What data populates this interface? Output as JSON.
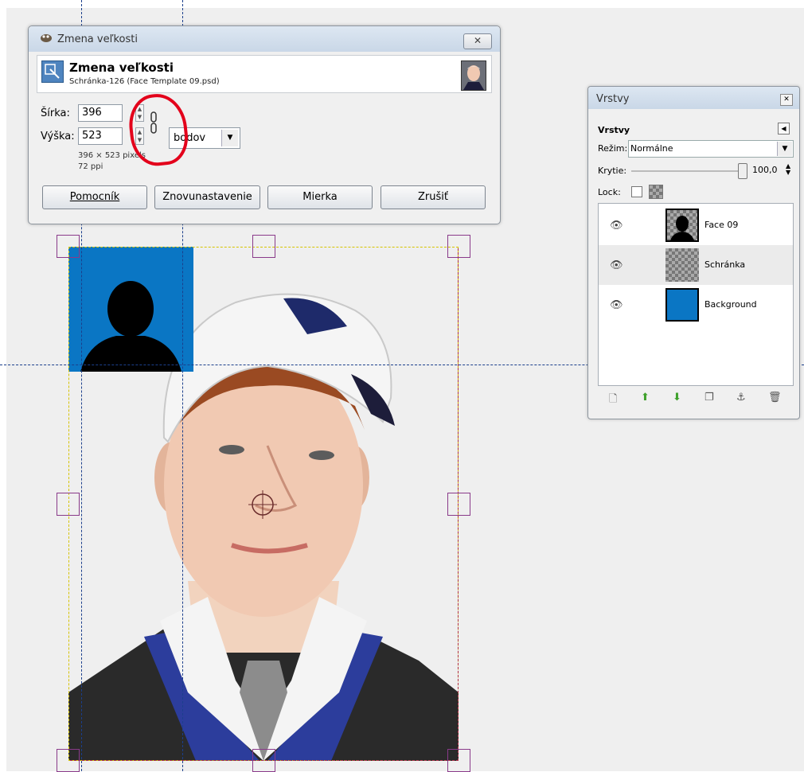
{
  "scale_dialog": {
    "window_title": "Zmena veľkosti",
    "heading": "Zmena veľkosti",
    "subtitle": "Schránka-126 (Face Template 09.psd)",
    "width_label": "Šírka:",
    "width_value": "396",
    "height_label": "Výška:",
    "height_value": "523",
    "size_info": "396 × 523 pixels",
    "resolution_info": "72 ppi",
    "unit_value": "bodov",
    "buttons": {
      "help": "Pomocník",
      "reset": "Znovunastavenie",
      "scale": "Mierka",
      "cancel": "Zrušiť"
    }
  },
  "layers_dialog": {
    "window_title": "Vrstvy",
    "tab_label": "Vrstvy",
    "mode_label": "Režim:",
    "mode_value": "Normálne",
    "opacity_label": "Krytie:",
    "opacity_value": "100,0",
    "lock_label": "Lock:",
    "layers": [
      {
        "name": "Face 09"
      },
      {
        "name": "Schránka"
      },
      {
        "name": "Background"
      }
    ]
  },
  "colors": {
    "placeholder_blue": "#0a76c4",
    "annotation_red": "#e3001b",
    "guide_blue": "#1b3f8c"
  }
}
